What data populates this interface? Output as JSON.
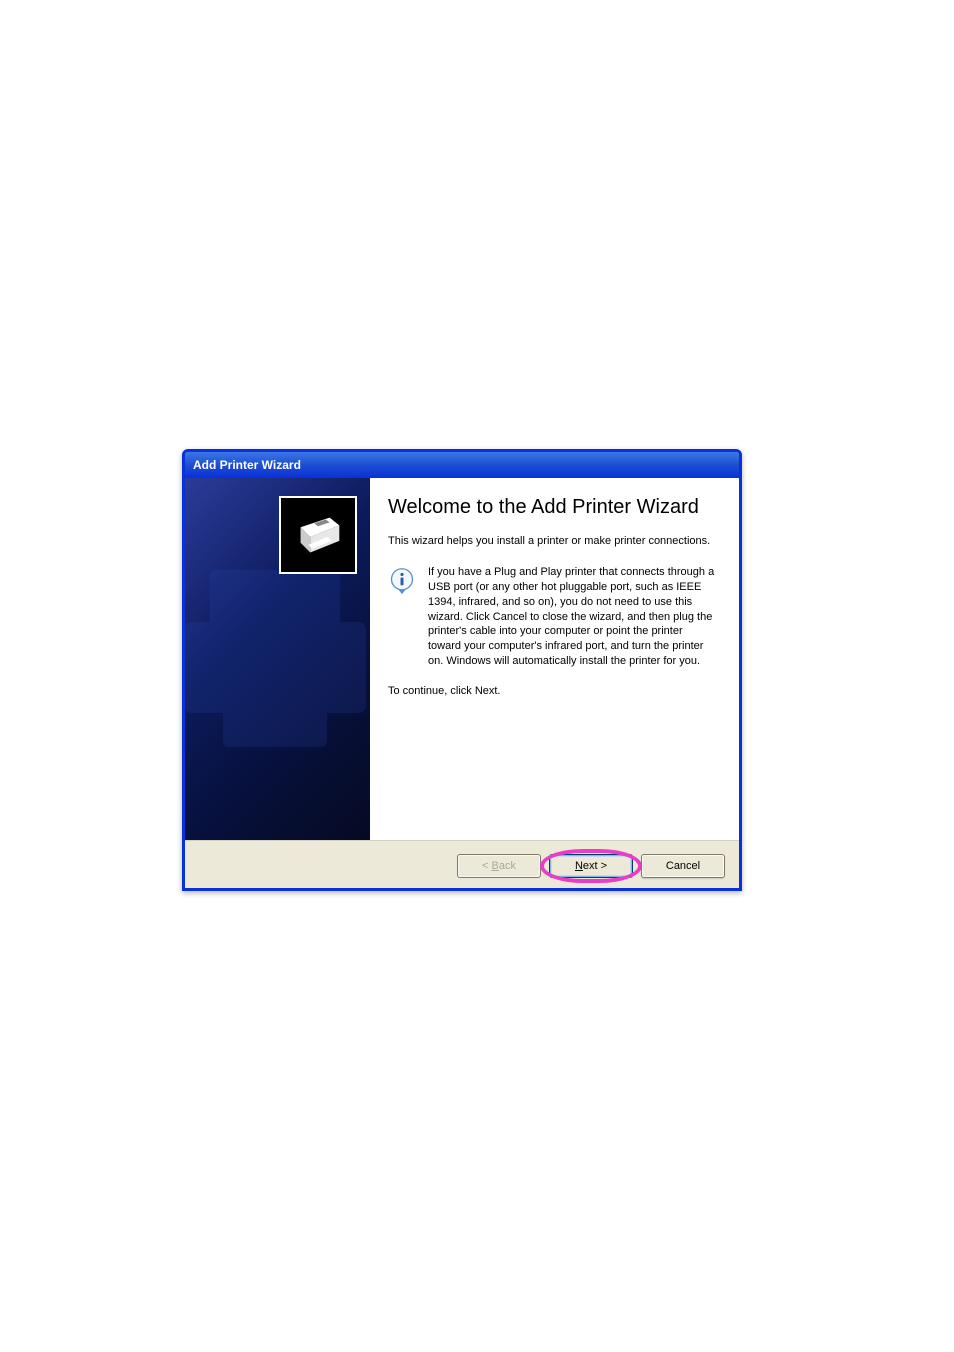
{
  "titlebar": {
    "title": "Add Printer Wizard"
  },
  "main": {
    "heading": "Welcome to the Add Printer Wizard",
    "description": "This wizard helps you install a printer or make printer connections.",
    "info_text": "If you have a Plug and Play printer that connects through a USB port (or any other hot pluggable port, such as IEEE 1394, infrared, and so on), you do not need to use this wizard. Click Cancel to close the wizard, and then plug the printer's cable into your computer or point the printer toward your computer's infrared port, and turn the printer on. Windows will automatically install the printer for you.",
    "continue_text": "To continue, click Next."
  },
  "buttons": {
    "back_prefix": "< ",
    "back_letter": "B",
    "back_suffix": "ack",
    "next_letter": "N",
    "next_suffix": "ext >",
    "cancel": "Cancel"
  },
  "icons": {
    "info": "info-icon",
    "printer": "printer-icon"
  }
}
